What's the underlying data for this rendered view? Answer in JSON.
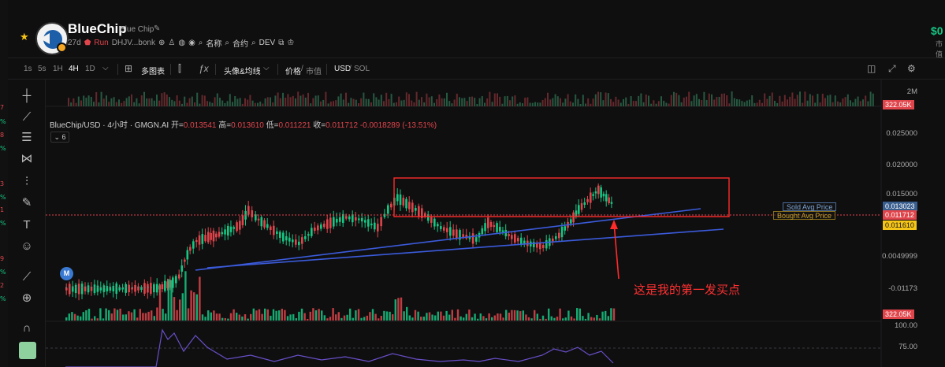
{
  "left_strip": [
    {
      "text": "7",
      "color": "#e0454b"
    },
    {
      "text": "%",
      "color": "#16c784"
    },
    {
      "text": "8",
      "color": "#e0454b"
    },
    {
      "text": "%",
      "color": "#16c784"
    },
    {
      "text": "3",
      "color": "#e0454b"
    },
    {
      "text": "%",
      "color": "#16c784"
    },
    {
      "text": "1",
      "color": "#e0454b"
    },
    {
      "text": "%",
      "color": "#16c784"
    },
    {
      "text": "9",
      "color": "#e0454b"
    },
    {
      "text": "%",
      "color": "#16c784"
    },
    {
      "text": "2",
      "color": "#e0454b"
    },
    {
      "text": "%",
      "color": "#16c784"
    }
  ],
  "header": {
    "token_name": "BlueChip",
    "token_sub": "Blue Chip",
    "age": "27d",
    "status": "Run",
    "address": "DHJV...bonk",
    "name_link": "名称",
    "contract_link": "合约",
    "dev_link": "DEV",
    "price_right": "$0",
    "price_right_sub": "市值"
  },
  "toolbar": {
    "intervals": [
      "1s",
      "5s",
      "1H",
      "4H",
      "1D"
    ],
    "active_interval": "4H",
    "multi_chart": "多图表",
    "avatar_ma": "头像&均线",
    "price_label": "价格",
    "mcap_label": "市值",
    "currency_usd": "USD",
    "currency_sol": "SOL"
  },
  "legend": {
    "pair": "BlueChip/USD · 4小时 · GMGN.AI",
    "open_label": "开=",
    "open": "0.013541",
    "high_label": "高=",
    "high": "0.013610",
    "low_label": "低=",
    "low": "0.011221",
    "close_label": "收=",
    "close": "0.011712",
    "change": "-0.0018289 (-13.51%)",
    "indicator_count": "6"
  },
  "axis": {
    "top_volume": "2M",
    "ticks": [
      "0.025000",
      "0.020000",
      "0.015000",
      "0.0049999",
      "-0.01173"
    ],
    "rsi_100": "100.00",
    "rsi_75": "75.00"
  },
  "price_tags": {
    "volume_top": "322.05K",
    "volume_bottom": "322.05K",
    "sold_avg_price": "0.013023",
    "current_price": "0.011712",
    "bought_avg_price": "0.011610"
  },
  "avg_lines": {
    "sold_label": "Sold Avg Price",
    "bought_label": "Bought Avg Price"
  },
  "annotation": {
    "text": "这是我的第一发买点",
    "color": "#ff3030"
  },
  "m_badge": "M",
  "colors": {
    "up": "#16c784",
    "down": "#e0454b",
    "trendline": "#3b5bdb",
    "rsi": "#6a4fc9",
    "box": "#ff2a2a"
  }
}
